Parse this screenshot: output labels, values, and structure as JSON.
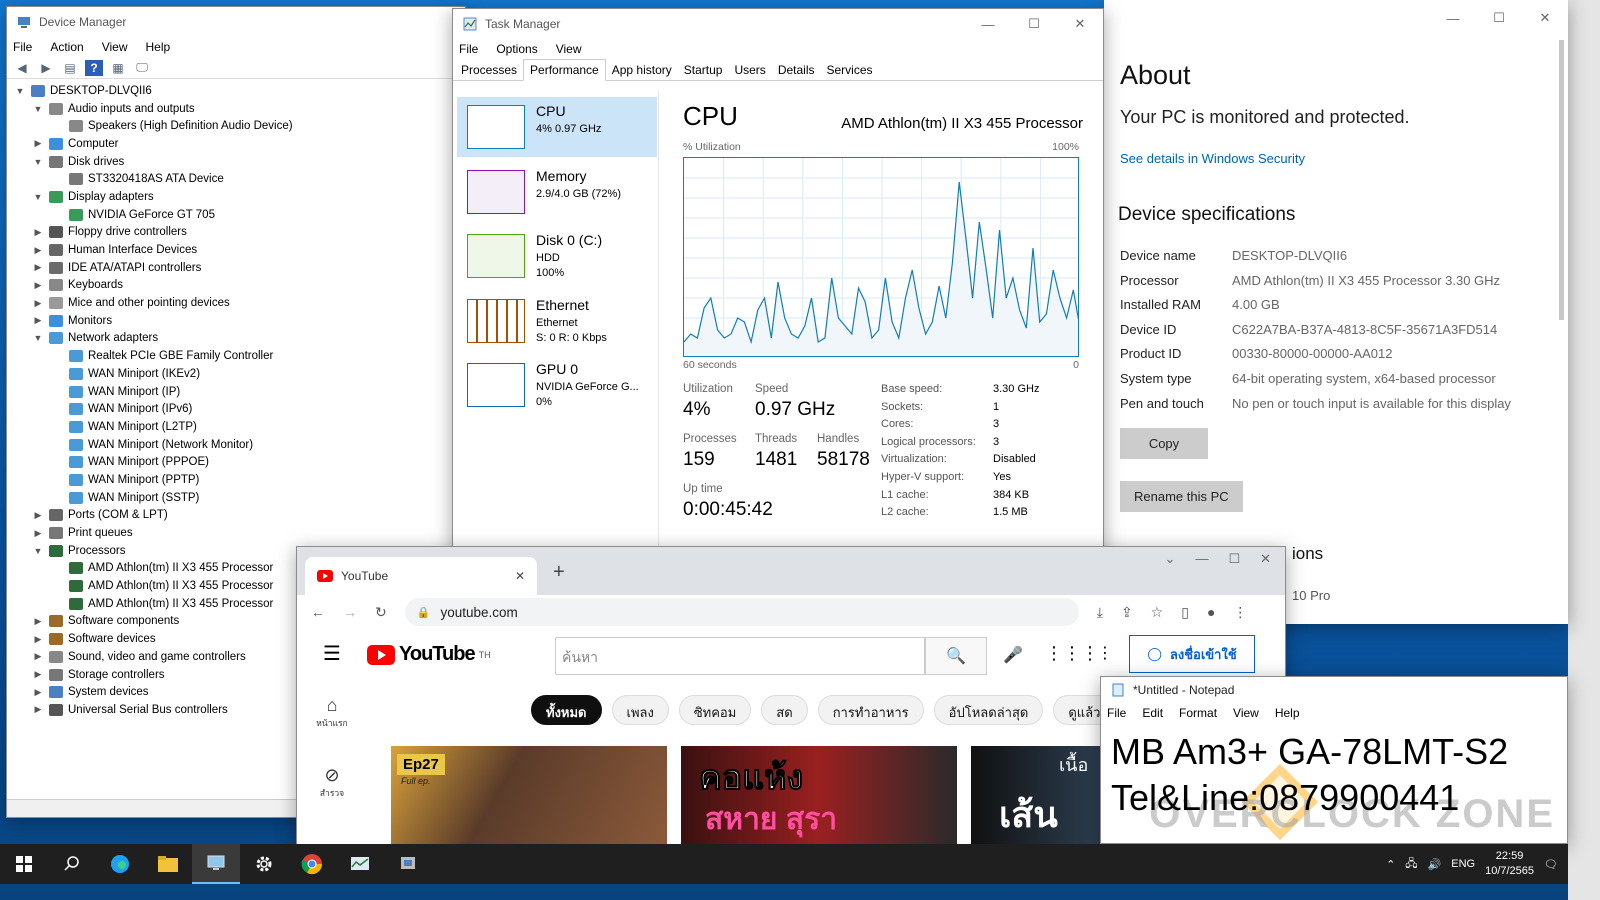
{
  "device_manager": {
    "title": "Device Manager",
    "menu": [
      "File",
      "Action",
      "View",
      "Help"
    ],
    "tree": [
      {
        "label": "DESKTOP-DLVQII6",
        "level": 0,
        "state": "open",
        "icon": "computer"
      },
      {
        "label": "Audio inputs and outputs",
        "level": 1,
        "state": "open",
        "icon": "speaker"
      },
      {
        "label": "Speakers (High Definition Audio Device)",
        "level": 2,
        "state": "leaf",
        "icon": "speaker"
      },
      {
        "label": "Computer",
        "level": 1,
        "state": "closed",
        "icon": "monitor"
      },
      {
        "label": "Disk drives",
        "level": 1,
        "state": "open",
        "icon": "disk"
      },
      {
        "label": "ST3320418AS ATA Device",
        "level": 2,
        "state": "leaf",
        "icon": "disk"
      },
      {
        "label": "Display adapters",
        "level": 1,
        "state": "open",
        "icon": "display"
      },
      {
        "label": "NVIDIA GeForce GT 705",
        "level": 2,
        "state": "leaf",
        "icon": "display"
      },
      {
        "label": "Floppy drive controllers",
        "level": 1,
        "state": "closed",
        "icon": "floppy"
      },
      {
        "label": "Human Interface Devices",
        "level": 1,
        "state": "closed",
        "icon": "hid"
      },
      {
        "label": "IDE ATA/ATAPI controllers",
        "level": 1,
        "state": "closed",
        "icon": "ide"
      },
      {
        "label": "Keyboards",
        "level": 1,
        "state": "closed",
        "icon": "keyboard"
      },
      {
        "label": "Mice and other pointing devices",
        "level": 1,
        "state": "closed",
        "icon": "mouse"
      },
      {
        "label": "Monitors",
        "level": 1,
        "state": "closed",
        "icon": "monitor"
      },
      {
        "label": "Network adapters",
        "level": 1,
        "state": "open",
        "icon": "network"
      },
      {
        "label": "Realtek PCIe GBE Family Controller",
        "level": 2,
        "state": "leaf",
        "icon": "network"
      },
      {
        "label": "WAN Miniport (IKEv2)",
        "level": 2,
        "state": "leaf",
        "icon": "network"
      },
      {
        "label": "WAN Miniport (IP)",
        "level": 2,
        "state": "leaf",
        "icon": "network"
      },
      {
        "label": "WAN Miniport (IPv6)",
        "level": 2,
        "state": "leaf",
        "icon": "network"
      },
      {
        "label": "WAN Miniport (L2TP)",
        "level": 2,
        "state": "leaf",
        "icon": "network"
      },
      {
        "label": "WAN Miniport (Network Monitor)",
        "level": 2,
        "state": "leaf",
        "icon": "network"
      },
      {
        "label": "WAN Miniport (PPPOE)",
        "level": 2,
        "state": "leaf",
        "icon": "network"
      },
      {
        "label": "WAN Miniport (PPTP)",
        "level": 2,
        "state": "leaf",
        "icon": "network"
      },
      {
        "label": "WAN Miniport (SSTP)",
        "level": 2,
        "state": "leaf",
        "icon": "network"
      },
      {
        "label": "Ports (COM & LPT)",
        "level": 1,
        "state": "closed",
        "icon": "port"
      },
      {
        "label": "Print queues",
        "level": 1,
        "state": "closed",
        "icon": "printer"
      },
      {
        "label": "Processors",
        "level": 1,
        "state": "open",
        "icon": "cpu"
      },
      {
        "label": "AMD Athlon(tm) II X3 455 Processor",
        "level": 2,
        "state": "leaf",
        "icon": "cpu"
      },
      {
        "label": "AMD Athlon(tm) II X3 455 Processor",
        "level": 2,
        "state": "leaf",
        "icon": "cpu"
      },
      {
        "label": "AMD Athlon(tm) II X3 455 Processor",
        "level": 2,
        "state": "leaf",
        "icon": "cpu"
      },
      {
        "label": "Software components",
        "level": 1,
        "state": "closed",
        "icon": "software"
      },
      {
        "label": "Software devices",
        "level": 1,
        "state": "closed",
        "icon": "software"
      },
      {
        "label": "Sound, video and game controllers",
        "level": 1,
        "state": "closed",
        "icon": "speaker"
      },
      {
        "label": "Storage controllers",
        "level": 1,
        "state": "closed",
        "icon": "storage"
      },
      {
        "label": "System devices",
        "level": 1,
        "state": "closed",
        "icon": "system"
      },
      {
        "label": "Universal Serial Bus controllers",
        "level": 1,
        "state": "closed",
        "icon": "usb"
      }
    ]
  },
  "settings": {
    "title": "About",
    "protected": "Your PC is monitored and protected.",
    "link": "See details in Windows Security",
    "spec_title": "Device specifications",
    "specs": [
      {
        "k": "Device name",
        "v": "DESKTOP-DLVQII6"
      },
      {
        "k": "Processor",
        "v": "AMD Athlon(tm) II X3 455 Processor   3.30 GHz"
      },
      {
        "k": "Installed RAM",
        "v": "4.00 GB"
      },
      {
        "k": "Device ID",
        "v": "C622A7BA-B37A-4813-8C5F-35671A3FD514"
      },
      {
        "k": "Product ID",
        "v": "00330-80000-00000-AA012"
      },
      {
        "k": "System type",
        "v": "64-bit operating system, x64-based processor"
      },
      {
        "k": "Pen and touch",
        "v": "No pen or touch input is available for this display"
      }
    ],
    "copy": "Copy",
    "rename": "Rename this PC",
    "partial_heading": "ions",
    "partial_edition": "10 Pro"
  },
  "task_manager": {
    "title": "Task Manager",
    "menu": [
      "File",
      "Options",
      "View"
    ],
    "tabs": [
      "Processes",
      "Performance",
      "App history",
      "Startup",
      "Users",
      "Details",
      "Services"
    ],
    "active_tab": "Performance",
    "resources": [
      {
        "name": "CPU",
        "lines": [
          "4% 0.97 GHz"
        ],
        "color": "#117dbb"
      },
      {
        "name": "Memory",
        "lines": [
          "2.9/4.0 GB (72%)"
        ],
        "color": "#8b12ae"
      },
      {
        "name": "Disk 0 (C:)",
        "lines": [
          "HDD",
          "100%"
        ],
        "color": "#4da60c"
      },
      {
        "name": "Ethernet",
        "lines": [
          "Ethernet",
          "S: 0 R: 0 Kbps"
        ],
        "color": "#a74f01"
      },
      {
        "name": "GPU 0",
        "lines": [
          "NVIDIA GeForce G...",
          "0%"
        ],
        "color": "#0e6ca8"
      }
    ],
    "cpu": {
      "heading": "CPU",
      "model": "AMD Athlon(tm) II X3 455 Processor",
      "util_label": "% Utilization",
      "max_label": "100%",
      "time_label": "60 seconds",
      "zero_label": "0",
      "stats": {
        "utilization_label": "Utilization",
        "utilization": "4%",
        "speed_label": "Speed",
        "speed": "0.97 GHz",
        "processes_label": "Processes",
        "processes": "159",
        "threads_label": "Threads",
        "threads": "1481",
        "handles_label": "Handles",
        "handles": "58178",
        "uptime_label": "Up time",
        "uptime": "0:00:45:42"
      },
      "details": [
        {
          "k": "Base speed:",
          "v": "3.30 GHz"
        },
        {
          "k": "Sockets:",
          "v": "1"
        },
        {
          "k": "Cores:",
          "v": "3"
        },
        {
          "k": "Logical processors:",
          "v": "3"
        },
        {
          "k": "Virtualization:",
          "v": "Disabled"
        },
        {
          "k": "Hyper-V support:",
          "v": "Yes"
        },
        {
          "k": "L1 cache:",
          "v": "384 KB"
        },
        {
          "k": "L2 cache:",
          "v": "1.5 MB"
        }
      ],
      "graph_values": [
        8,
        12,
        10,
        25,
        30,
        14,
        10,
        12,
        20,
        18,
        8,
        24,
        30,
        10,
        38,
        20,
        12,
        10,
        16,
        30,
        8,
        10,
        40,
        20,
        16,
        12,
        35,
        28,
        10,
        14,
        40,
        18,
        10,
        30,
        44,
        25,
        12,
        18,
        36,
        20,
        48,
        88,
        60,
        30,
        68,
        45,
        20,
        64,
        30,
        40,
        24,
        15,
        55,
        18,
        22,
        44,
        30,
        20,
        34,
        15
      ]
    }
  },
  "chrome": {
    "tab_title": "YouTube",
    "url": "youtube.com",
    "yt_logo": "YouTube",
    "yt_region": "TH",
    "search_placeholder": "ค้นหา",
    "signin": "ลงชื่อเข้าใช้",
    "chips": [
      "ทั้งหมด",
      "เพลง",
      "ซิทคอม",
      "สด",
      "การทำอาหาร",
      "อัปโหลดล่าสุด",
      "ดูแล้ว"
    ],
    "side": [
      "หน้าแรก",
      "สำรวจ"
    ],
    "thumb1_text": "Ep27",
    "thumb1_sub": "Full ep.",
    "thumb2_text": "คอแห้ง",
    "thumb2_text2": "สหาย สุรา",
    "thumb3_text": "เนื้อ",
    "thumb3_text2": "เส้น"
  },
  "notepad": {
    "title": "*Untitled - Notepad",
    "menu": [
      "File",
      "Edit",
      "Format",
      "View",
      "Help"
    ],
    "lines": [
      "MB Am3+ GA-78LMT-S2",
      "Tel&Line:0879900441"
    ],
    "watermark": "OVERCLOCK ZONE"
  },
  "taskbar": {
    "lang": "ENG",
    "time": "22:59",
    "date": "10/7/2565"
  }
}
